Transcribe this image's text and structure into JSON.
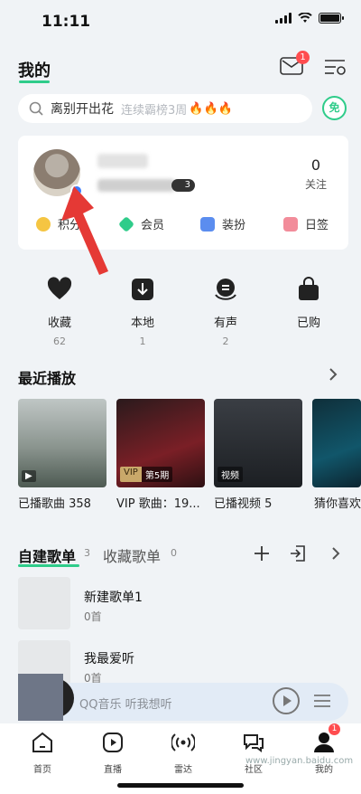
{
  "status": {
    "time": "11:11"
  },
  "header": {
    "title": "我的",
    "mail_badge": "1"
  },
  "search": {
    "query": "离别开出花",
    "hint": "连续霸榜3周",
    "free_label": "免"
  },
  "profile": {
    "level": "3",
    "follow_count": "0",
    "follow_label": "关注",
    "quick_links": [
      "积分",
      "会员",
      "装扮",
      "日签"
    ]
  },
  "features": [
    {
      "label": "收藏",
      "count": "62",
      "icon": "heart-icon"
    },
    {
      "label": "本地",
      "count": "1",
      "icon": "download-icon"
    },
    {
      "label": "有声",
      "count": "2",
      "icon": "audio-icon"
    },
    {
      "label": "已购",
      "count": "",
      "icon": "bag-icon"
    }
  ],
  "recent": {
    "title": "最近播放",
    "cards": [
      {
        "caption": "已播歌曲 358",
        "tag": ""
      },
      {
        "caption": "VIP 歌曲：19...",
        "tag_vip": "VIP",
        "tag_ep": "第5期"
      },
      {
        "caption": "已播视频 5",
        "tag": "视频"
      },
      {
        "caption": "猜你喜欢",
        "tag": ""
      }
    ]
  },
  "playlists": {
    "tab_created": "自建歌单",
    "tab_created_count": "3",
    "tab_collected": "收藏歌单",
    "tab_collected_count": "0",
    "items": [
      {
        "name": "新建歌单1",
        "count": "0首"
      },
      {
        "name": "我最爱听",
        "count": "0首"
      }
    ]
  },
  "player": {
    "text": "QQ音乐 听我想听"
  },
  "nav": {
    "items": [
      "首页",
      "直播",
      "雷达",
      "社区",
      "我的"
    ],
    "badge": "1",
    "watermark": "www.jingyan.baidu.com"
  },
  "colors": {
    "accent": "#2fcc8a",
    "badge": "#ff4d4f"
  }
}
